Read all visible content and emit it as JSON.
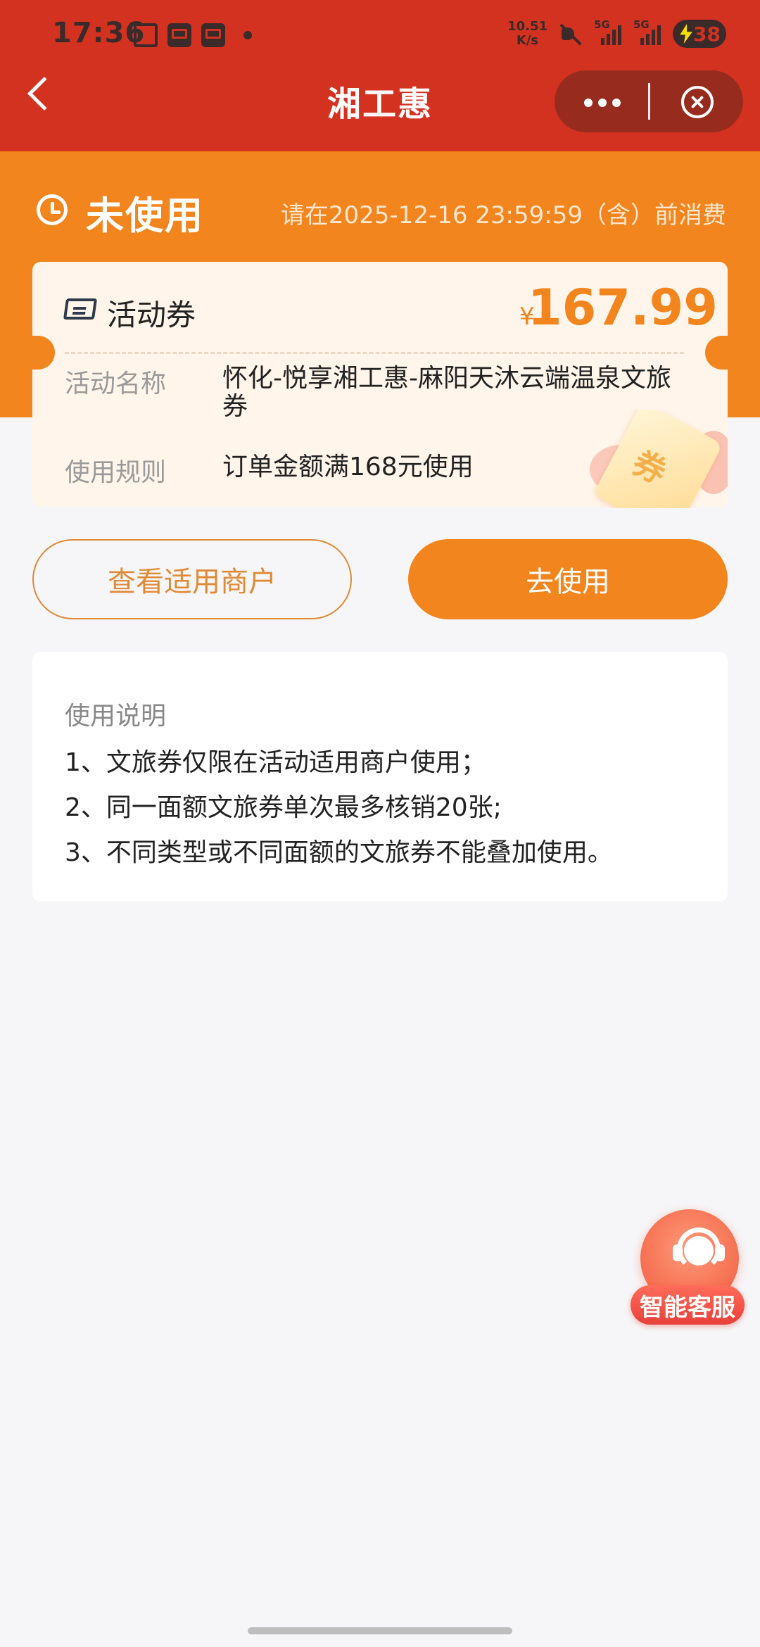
{
  "status_bar": {
    "time": "17:36",
    "net_speed_value": "10.51",
    "net_speed_unit": "K/s",
    "signal1_label": "5G",
    "signal2_label": "5G",
    "battery_level": "38"
  },
  "nav": {
    "title": "湘工惠"
  },
  "coupon": {
    "status": "未使用",
    "deadline": "请在2025-12-16 23:59:59（含）前消费",
    "type": "活动券",
    "currency": "¥",
    "amount": "167.99",
    "activity_name_label": "活动名称",
    "activity_name": "怀化-悦享湘工惠-麻阳天沐云端温泉文旅券",
    "rule_label": "使用规则",
    "rule": "订单金额满168元使用",
    "deco_text": "券"
  },
  "actions": {
    "view_merchants": "查看适用商户",
    "use": "去使用"
  },
  "instructions": {
    "title": "使用说明",
    "items": [
      "1、文旅券仅限在活动适用商户使用；",
      "2、同一面额文旅券单次最多核销20张;",
      "3、不同类型或不同面额的文旅券不能叠加使用。"
    ]
  },
  "service": {
    "label": "智能客服"
  },
  "colors": {
    "header_red": "#d43221",
    "header_orange": "#f2851d",
    "accent": "#f2851d",
    "page_bg": "#f6f6f8"
  }
}
